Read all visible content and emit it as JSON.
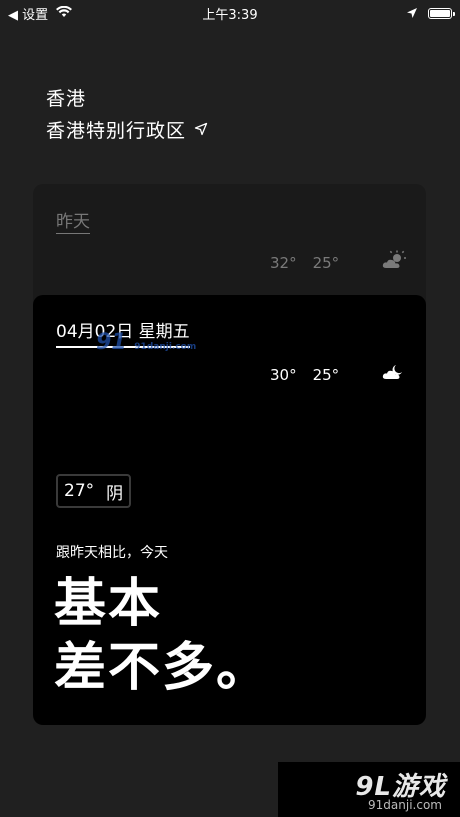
{
  "status_bar": {
    "back_app": "◀ 设置",
    "time": "上午3:39"
  },
  "location": {
    "city": "香港",
    "region": "香港特别行政区"
  },
  "yesterday": {
    "label": "昨天",
    "high": "32°",
    "low": "25°",
    "icon": "partly-sunny-icon"
  },
  "today": {
    "date": "04月02日 星期五",
    "high": "30°",
    "low": "25°",
    "icon": "partly-cloudy-icon",
    "current_temp": "27°",
    "condition": "阴",
    "compare_text": "跟昨天相比，今天",
    "summary_line1": "基本",
    "summary_line2": "差不多。"
  },
  "watermark": {
    "text": "91",
    "url": "91danji.com"
  },
  "logo": {
    "text": "9L游戏",
    "url": "91danji.com"
  },
  "colors": {
    "background": "#202020",
    "card_yesterday": "#1a1a1a",
    "card_today": "#000000"
  }
}
